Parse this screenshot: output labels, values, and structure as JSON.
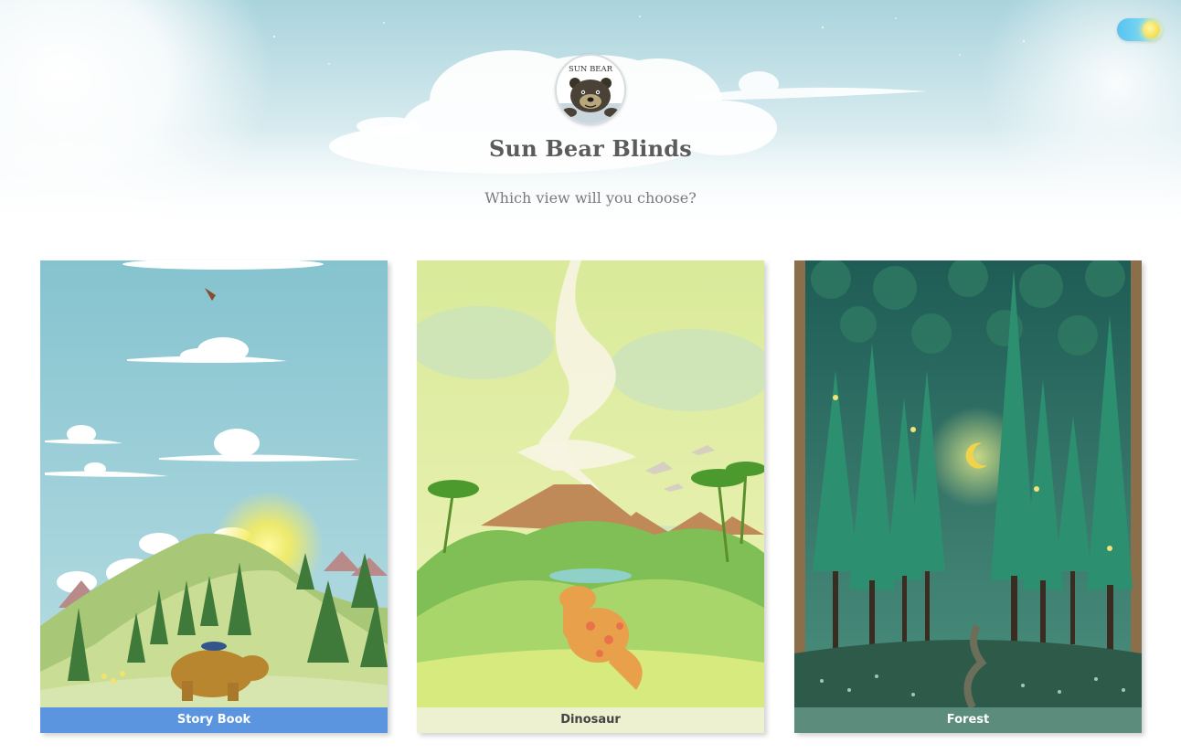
{
  "header": {
    "title": "Sun Bear Blinds",
    "subtitle": "Which view will you choose?",
    "logo_text": "SUN BEAR"
  },
  "theme_toggle": {
    "state": "day",
    "icon": "sun-icon"
  },
  "views": [
    {
      "label": "Story Book",
      "label_bg": "#5b95e0",
      "label_color": "#ffffff",
      "scene": "bear-mountain-meadow"
    },
    {
      "label": "Dinosaur",
      "label_bg": "#eef1cf",
      "label_color": "#444444",
      "scene": "dinosaur-volcano-jungle"
    },
    {
      "label": "Forest",
      "label_bg": "#5b8c7c",
      "label_color": "#ffffff",
      "scene": "night-pine-forest"
    }
  ],
  "colors": {
    "sky": "#a9d3dc",
    "title_text": "#5b5b5b",
    "subtitle_text": "#7a7a7a"
  }
}
